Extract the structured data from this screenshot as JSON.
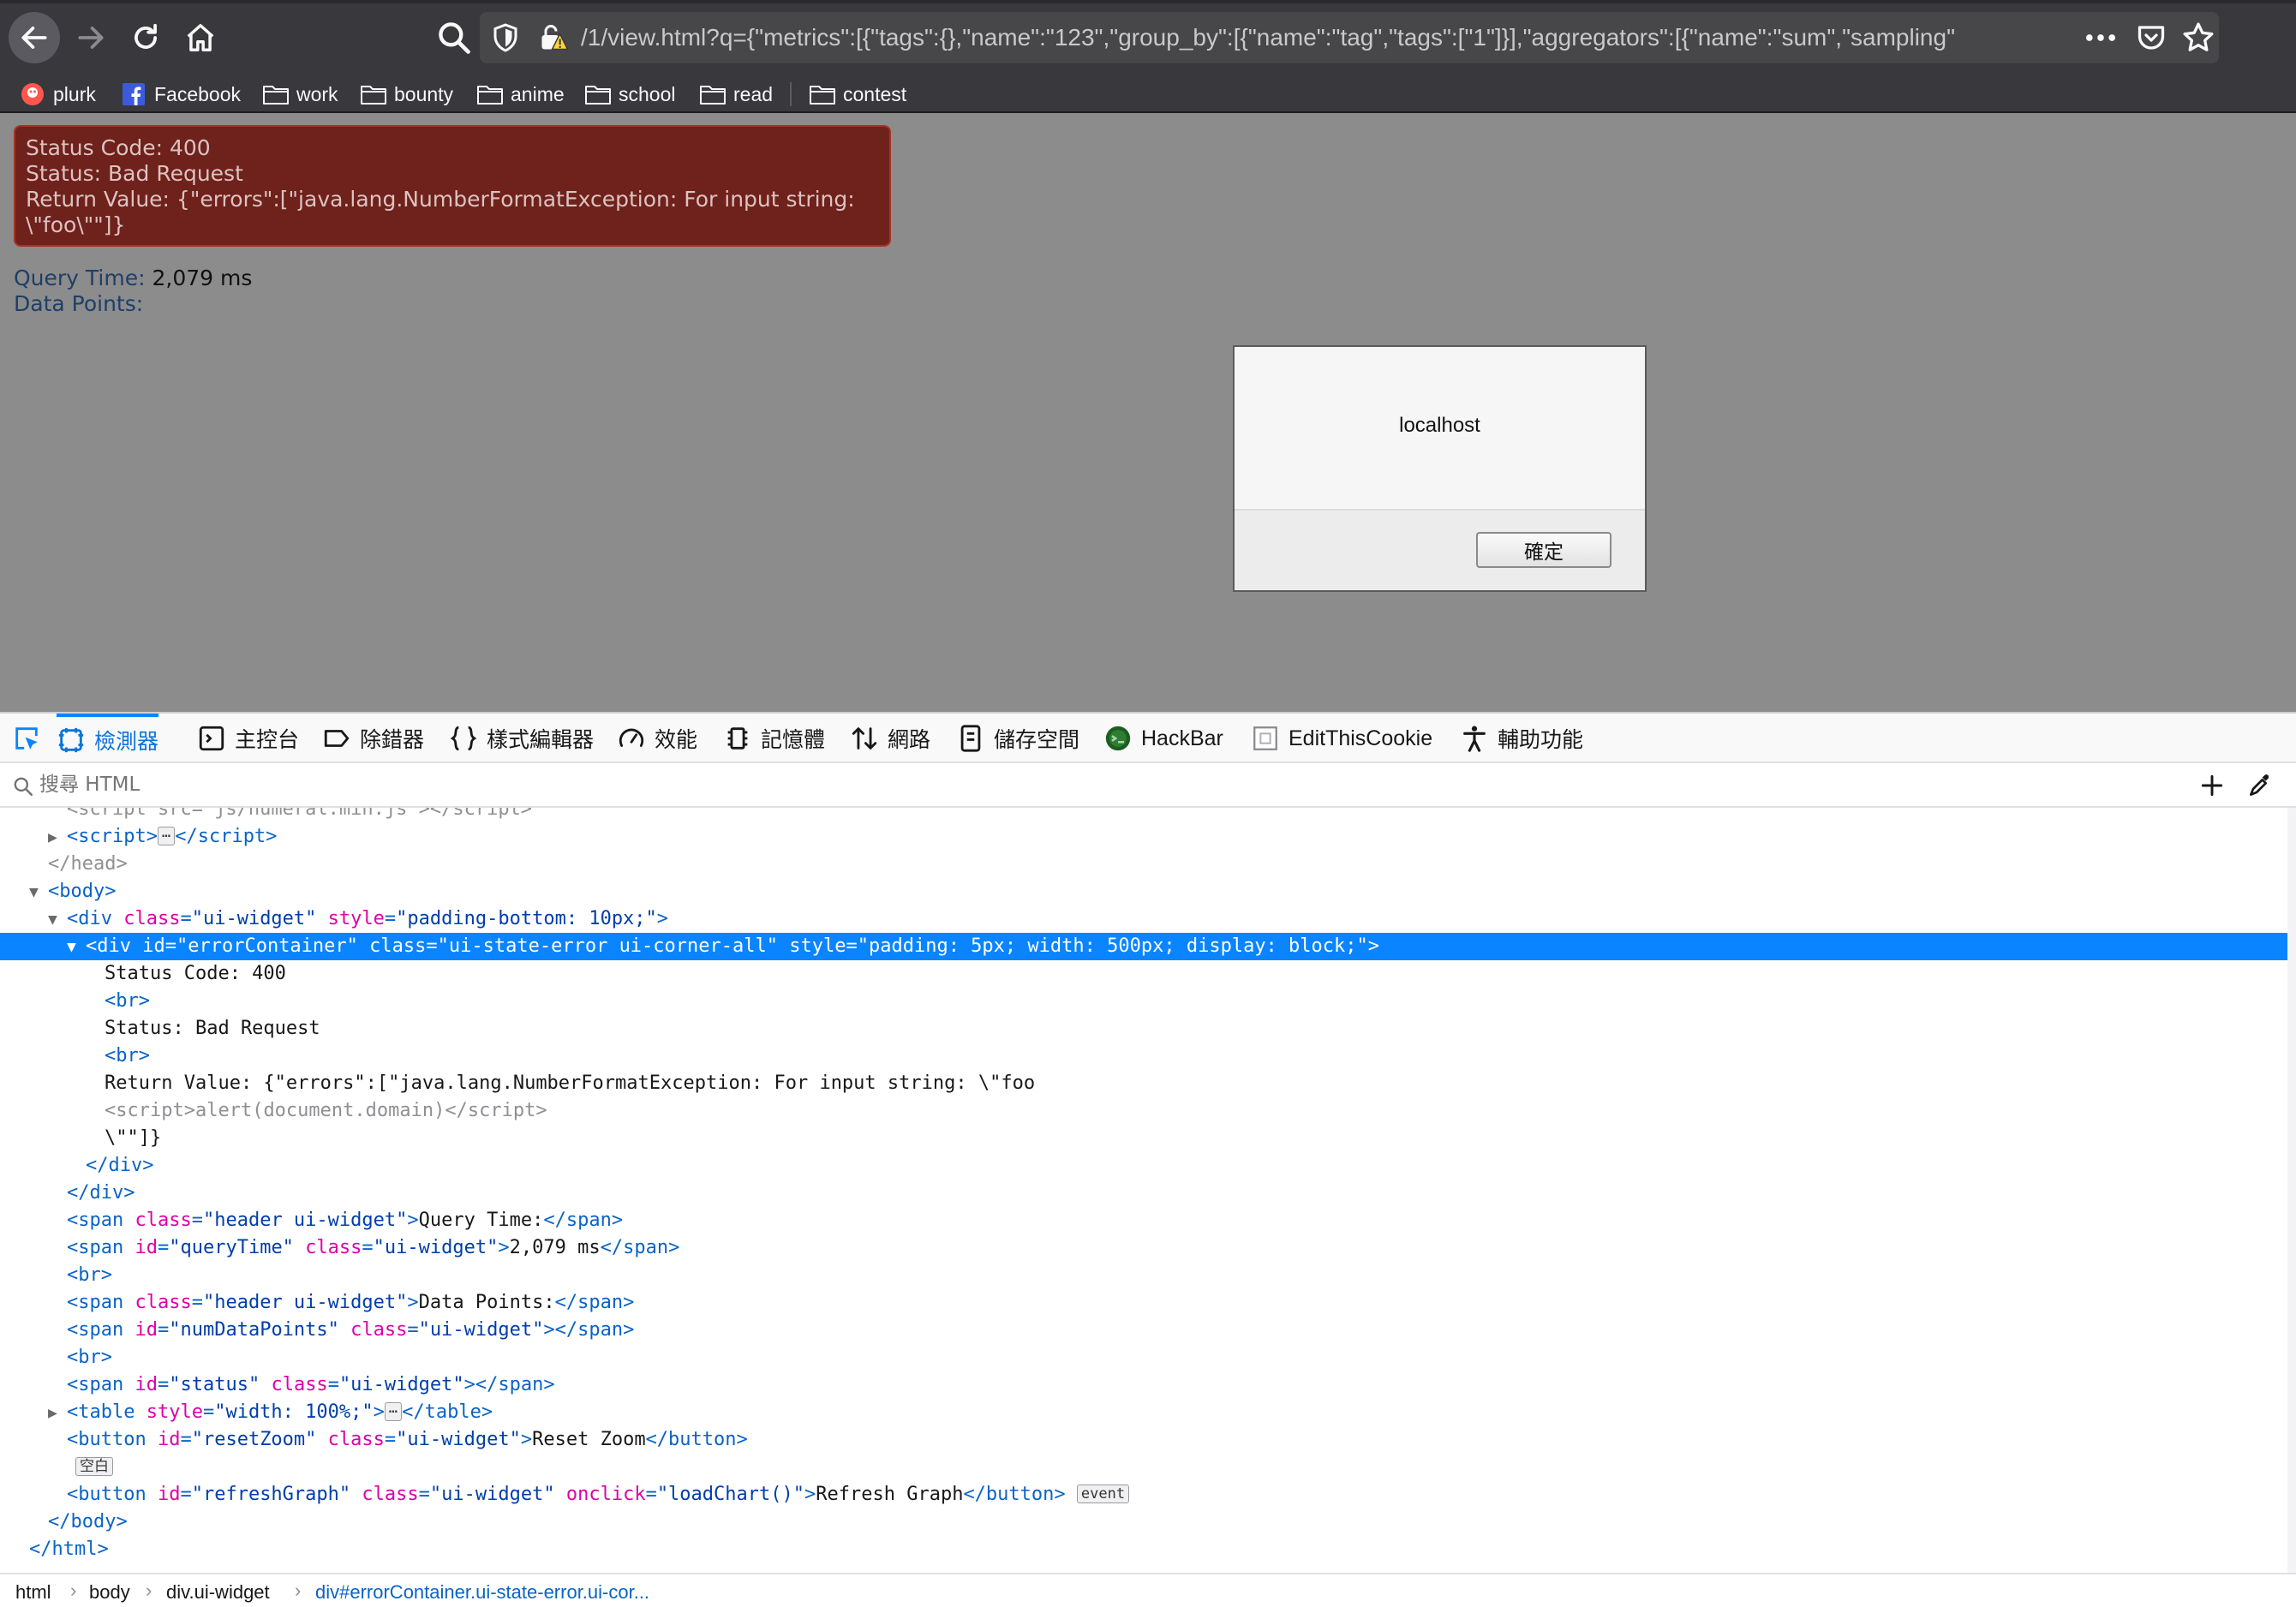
{
  "browser": {
    "url": "/1/view.html?q={\"metrics\":[{\"tags\":{},\"name\":\"123\",\"group_by\":[{\"name\":\"tag\",\"tags\":[\"1\"]}],\"aggregators\":[{\"name\":\"sum\",\"sampling\"",
    "bookmarks": [
      "plurk",
      "Facebook",
      "work",
      "bounty",
      "anime",
      "school",
      "read",
      "contest"
    ]
  },
  "page": {
    "error": {
      "status_code": "Status Code: 400",
      "status": "Status: Bad Request",
      "return_value_1": "Return Value: {\"errors\":[\"java.lang.NumberFormatException: For input string:",
      "return_value_2": "\\\"foo\\\"\"]}"
    },
    "query_time_label": "Query Time:",
    "query_time_value": "2,079 ms",
    "data_points_label": "Data Points:"
  },
  "alert": {
    "origin": "localhost",
    "ok_label": "確定"
  },
  "devtools": {
    "tabs": [
      "檢測器",
      "主控台",
      "除錯器",
      "樣式編輯器",
      "效能",
      "記憶體",
      "網路",
      "儲存空間",
      "HackBar",
      "EditThisCookie",
      "輔助功能"
    ],
    "search_placeholder": "搜尋 HTML",
    "markup": {
      "l0": "js/numeral.min.js",
      "l7_text": "Status Code: 400",
      "l9_text": "Status: Bad Request",
      "l11_text": "Return Value: {\"errors\":[\"java.lang.NumberFormatException: For input string: \\\"foo",
      "l12_script": "alert(document.domain)",
      "l13_text": "\\\"\"]}",
      "l17_text": "Query Time:",
      "l18_text": "2,079 ms",
      "l20_text": "Data Points:",
      "l25_text": "Reset Zoom",
      "l26_badge": "空白",
      "l27_text": "Refresh Graph",
      "l27_badge": "event"
    },
    "breadcrumbs": [
      "html",
      "body",
      "div.ui-widget",
      "div#errorContainer.ui-state-error.ui-cor..."
    ]
  }
}
